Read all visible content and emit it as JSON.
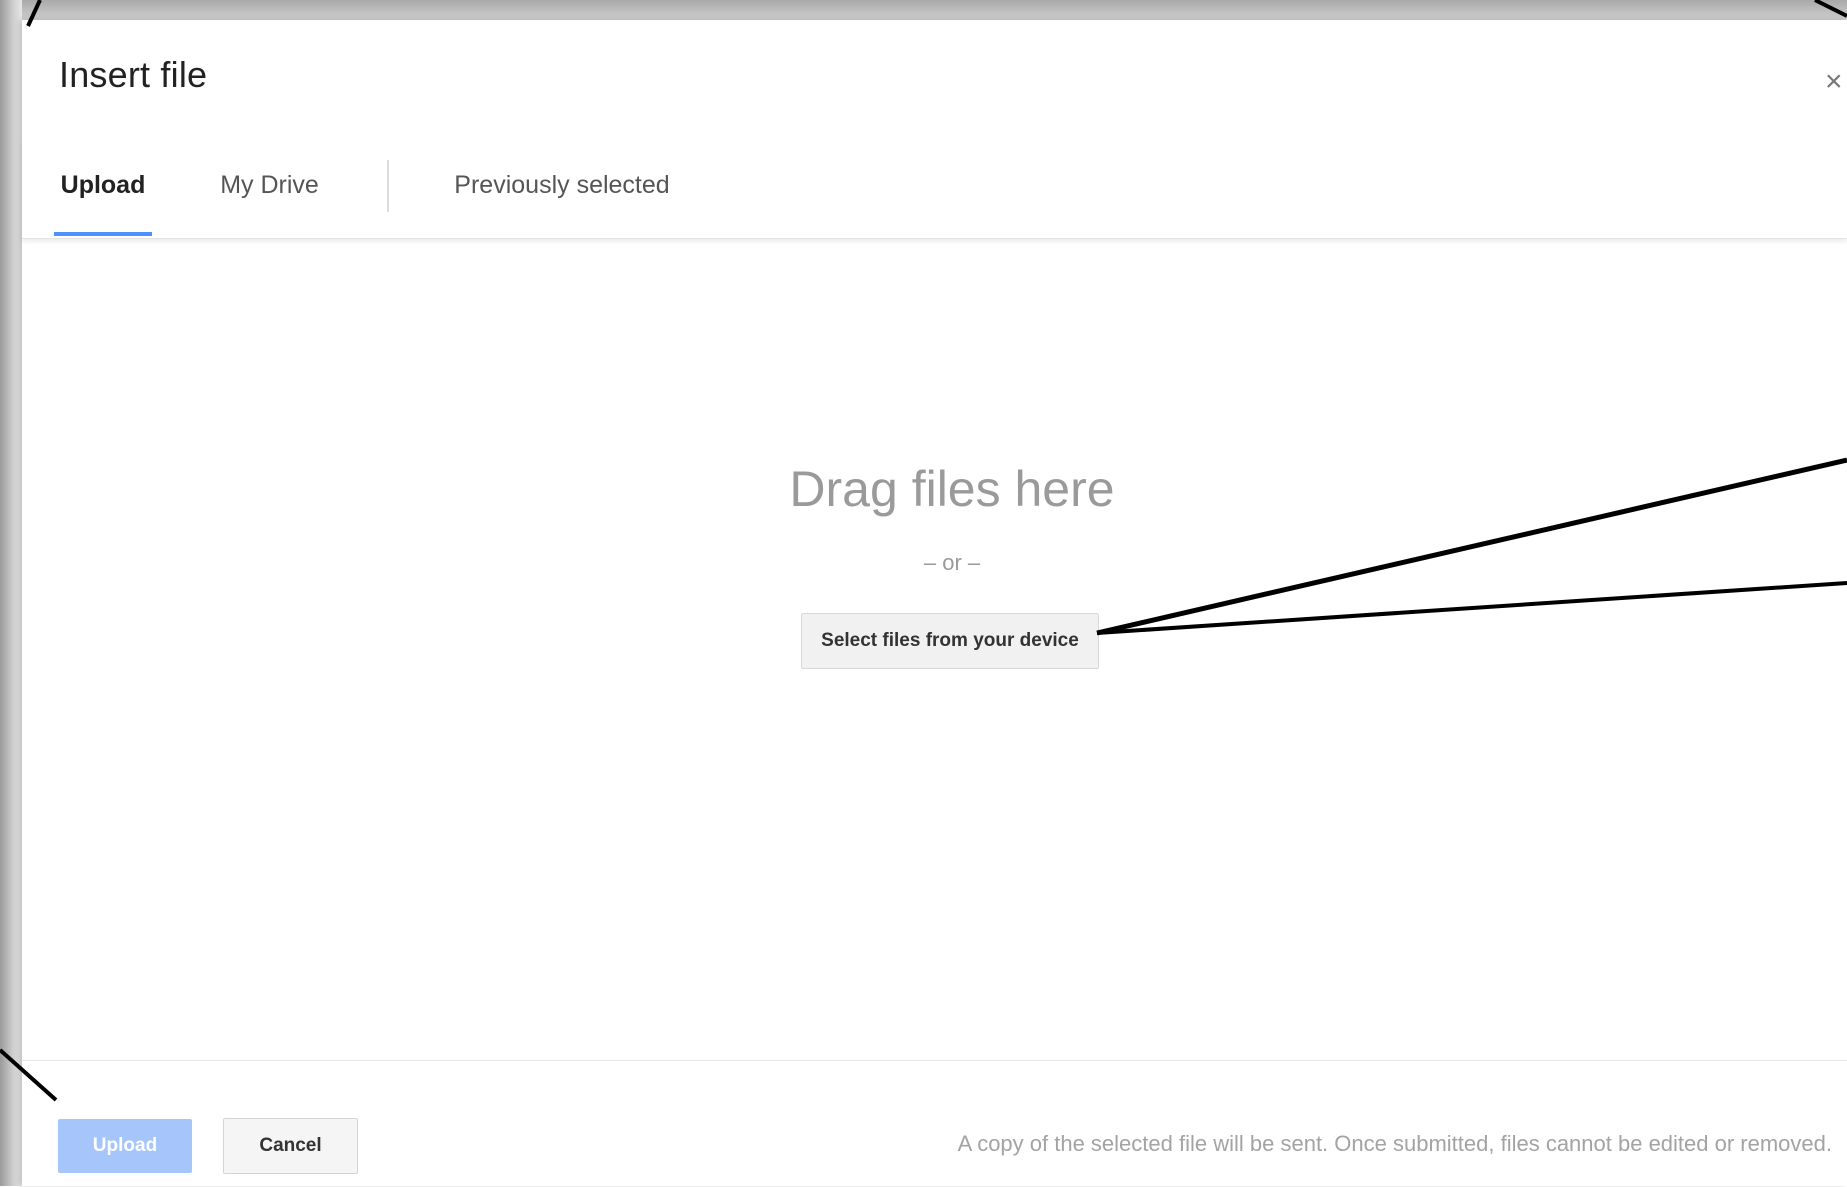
{
  "dialog": {
    "title": "Insert file",
    "close_icon": "×"
  },
  "tabs": [
    {
      "label": "Upload",
      "active": true
    },
    {
      "label": "My Drive",
      "active": false
    },
    {
      "label": "Previously selected",
      "active": false
    }
  ],
  "drop_zone": {
    "heading": "Drag files here",
    "separator": "– or –",
    "select_button": "Select files from your device"
  },
  "footer": {
    "upload_label": "Upload",
    "cancel_label": "Cancel",
    "note": "A copy of the selected file will be sent. Once submitted, files cannot be edited or removed."
  },
  "colors": {
    "accent": "#4d90fe",
    "upload_disabled": "#a6c5fb"
  }
}
